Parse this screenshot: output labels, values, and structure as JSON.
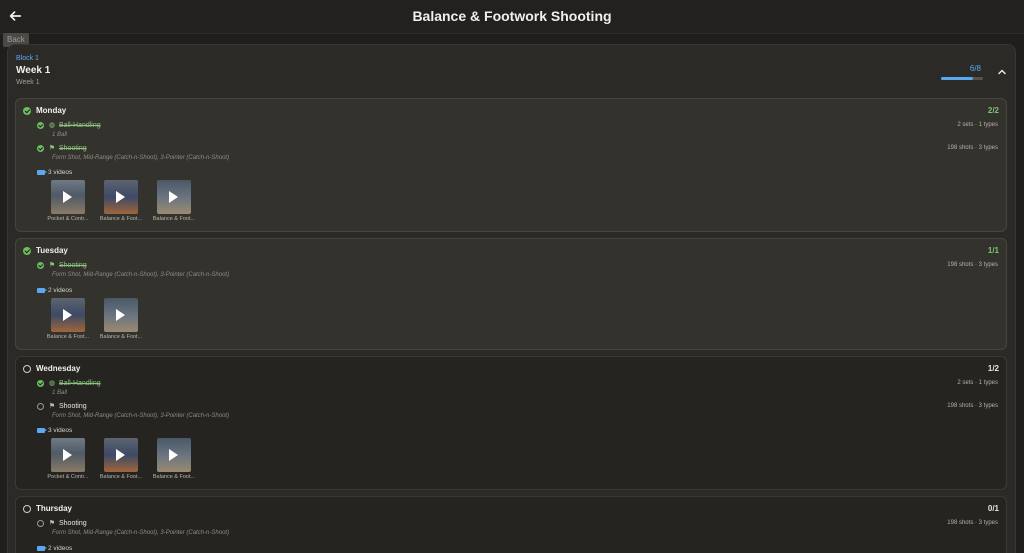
{
  "header": {
    "title": "Balance & Footwork Shooting",
    "back_tooltip": "Back"
  },
  "block": {
    "label": "Block 1",
    "week_title": "Week 1",
    "week_subtitle": "Week 1",
    "progress_text": "6/8",
    "progress_fraction": 0.75
  },
  "days": [
    {
      "name": "Monday",
      "count": "2/2",
      "done": true,
      "items": [
        {
          "name": "Ball-Handling",
          "sub": "1 Ball",
          "meta": "2 sets · 1 types",
          "done": true,
          "icon": "basketball-icon"
        },
        {
          "name": "Shooting",
          "sub": "Form Shot, Mid-Range (Catch-n-Shoot), 3-Pointer (Catch-n-Shoot)",
          "meta": "198 shots · 3 types",
          "done": true,
          "icon": "flag-icon"
        }
      ],
      "videos_label": "3 videos",
      "videos": [
        "Pocket & Contr...",
        "Balance & Foot...",
        "Balance & Foot..."
      ]
    },
    {
      "name": "Tuesday",
      "count": "1/1",
      "done": true,
      "items": [
        {
          "name": "Shooting",
          "sub": "Form Shot, Mid-Range (Catch-n-Shoot), 3-Pointer (Catch-n-Shoot)",
          "meta": "198 shots · 3 types",
          "done": true,
          "icon": "flag-icon"
        }
      ],
      "videos_label": "2 videos",
      "videos": [
        "Balance & Foot...",
        "Balance & Foot..."
      ]
    },
    {
      "name": "Wednesday",
      "count": "1/2",
      "done": false,
      "items": [
        {
          "name": "Ball-Handling",
          "sub": "1 Ball",
          "meta": "2 sets · 1 types",
          "done": true,
          "icon": "basketball-icon"
        },
        {
          "name": "Shooting",
          "sub": "Form Shot, Mid-Range (Catch-n-Shoot), 3-Pointer (Catch-n-Shoot)",
          "meta": "198 shots · 3 types",
          "done": false,
          "icon": "flag-icon"
        }
      ],
      "videos_label": "3 videos",
      "videos": [
        "Pocket & Contr...",
        "Balance & Foot...",
        "Balance & Foot..."
      ]
    },
    {
      "name": "Thursday",
      "count": "0/1",
      "done": false,
      "items": [
        {
          "name": "Shooting",
          "sub": "Form Shot, Mid-Range (Catch-n-Shoot), 3-Pointer (Catch-n-Shoot)",
          "meta": "198 shots · 3 types",
          "done": false,
          "icon": "flag-icon"
        }
      ],
      "videos_label": "2 videos",
      "videos": []
    }
  ],
  "colors": {
    "accent": "#5aa9f0",
    "done": "#6bbf5e",
    "background": "#1f1e1c"
  }
}
